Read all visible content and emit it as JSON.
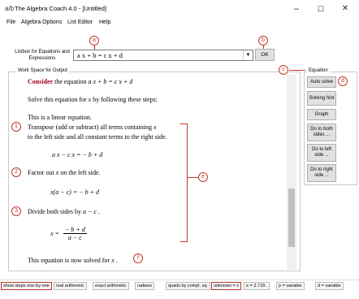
{
  "window": {
    "title": "The Algebra Coach 4.0 - [Untitled]",
    "app_icon": "a/b",
    "minimize": "–",
    "maximize": "☐",
    "close": "✕"
  },
  "menu": [
    "File",
    "Algebra Options",
    "List Editor",
    "Help"
  ],
  "input": {
    "label": "Listbox for Equations and Expressions",
    "value": "a x + b = c x + d",
    "ok_label": "OK"
  },
  "workspace": {
    "legend": "Work Space for Output",
    "consider_word": "Consider",
    "consider_rest": "the equation",
    "consider_math": "a x + b = c x + d",
    "solve_text_1": "Solve this equation for",
    "solve_var": "x",
    "solve_text_2": "by following these steps:",
    "linear": "This is a linear equation.",
    "step1_a": "Transpose (add or subtract) all terms containing",
    "step1_var": "x",
    "step1_b": "to the left side and all constant terms to the right side.",
    "step1_math": "a x − c x = − b + d",
    "step2_a": "Factor out",
    "step2_var": "x",
    "step2_b": "on the left side.",
    "step2_math": "x(a − c) = − b + d",
    "step3_a": "Divide both sides by",
    "step3_math_inline": "a − c",
    "step3_dot": ".",
    "result_lhs": "x =",
    "result_num": "− b + d",
    "result_den": "a − c",
    "solved_a": "This equation is now solved for",
    "solved_var": "x",
    "solved_dot": "."
  },
  "equation_panel": {
    "legend": "Equation",
    "buttons": [
      "Auto solve",
      "Solving hint",
      "Graph",
      "Do to both sides ...",
      "Do to left side ...",
      "Do to right side ..."
    ]
  },
  "annotations": [
    "a",
    "b",
    "c",
    "d",
    "e",
    "f",
    "1",
    "2",
    "3"
  ],
  "status": [
    "show steps one-by-one",
    "real arithmetic",
    "exact arithmetic",
    "radians",
    "quads by compl. sq.",
    "unknown = x",
    "e = 2.718..",
    "p = variable",
    "d = variable"
  ],
  "colors": {
    "annotation": "#c0392b",
    "consider": "#a0001a"
  }
}
